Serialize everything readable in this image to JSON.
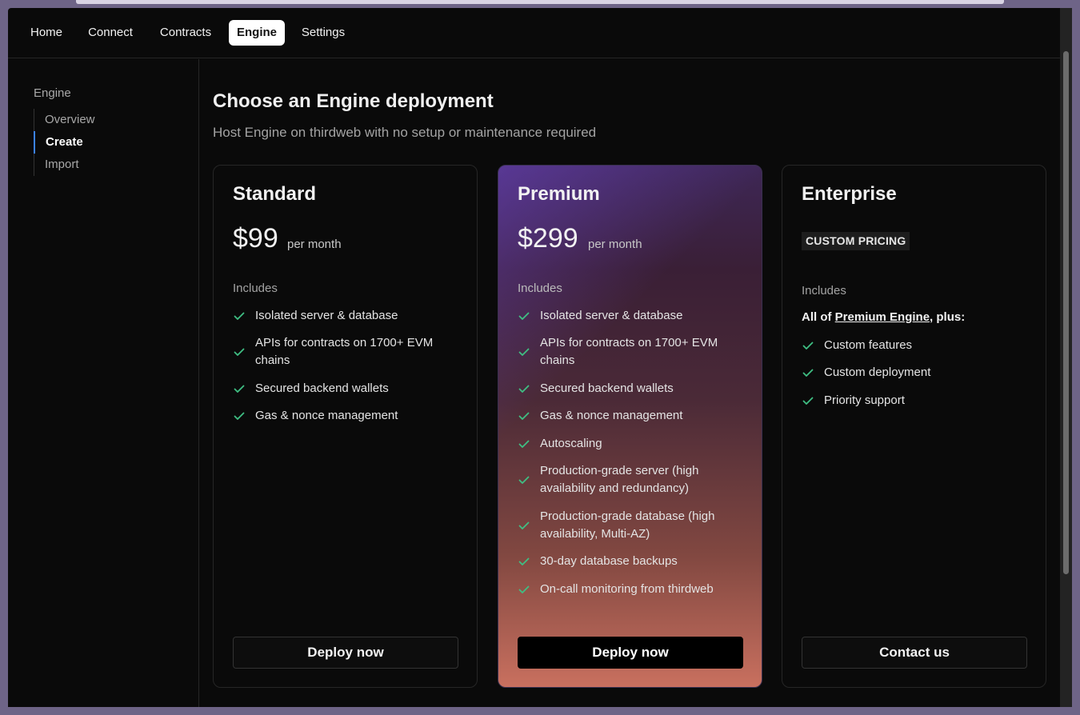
{
  "nav": {
    "tabs": [
      {
        "label": "Home"
      },
      {
        "label": "Connect"
      },
      {
        "label": "Contracts"
      },
      {
        "label": "Engine",
        "active": true
      },
      {
        "label": "Settings"
      }
    ]
  },
  "sidebar": {
    "heading": "Engine",
    "items": [
      {
        "label": "Overview"
      },
      {
        "label": "Create",
        "active": true
      },
      {
        "label": "Import"
      }
    ]
  },
  "main": {
    "title": "Choose an Engine deployment",
    "subtitle": "Host Engine on thirdweb with no setup or maintenance required"
  },
  "plans": [
    {
      "name": "Standard",
      "price": "$99",
      "per": "per month",
      "includes_label": "Includes",
      "features": [
        "Isolated server & database",
        "APIs for contracts on 1700+ EVM chains",
        "Secured backend wallets",
        "Gas & nonce management"
      ],
      "button": "Deploy now"
    },
    {
      "name": "Premium",
      "price": "$299",
      "per": "per month",
      "includes_label": "Includes",
      "features": [
        "Isolated server & database",
        "APIs for contracts on 1700+ EVM chains",
        "Secured backend wallets",
        "Gas & nonce management",
        "Autoscaling",
        "Production-grade server (high availability and redundancy)",
        "Production-grade database (high availability, Multi-AZ)",
        "30-day database backups",
        "On-call monitoring from thirdweb"
      ],
      "button": "Deploy now"
    },
    {
      "name": "Enterprise",
      "badge": "CUSTOM PRICING",
      "includes_label": "Includes",
      "plus_prefix": "All of ",
      "plus_link": "Premium Engine",
      "plus_suffix": ", plus:",
      "features": [
        "Custom features",
        "Custom deployment",
        "Priority support"
      ],
      "button": "Contact us"
    }
  ],
  "colors": {
    "check": "#3fbf83",
    "accent_indicator": "#3b82f6"
  }
}
